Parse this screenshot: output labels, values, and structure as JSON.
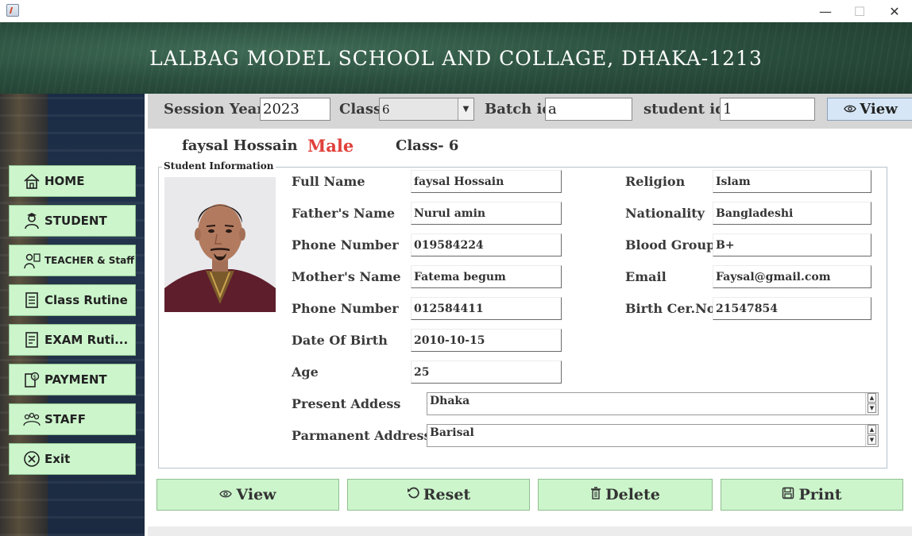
{
  "window": {
    "minimize": "—",
    "maximize": "☐",
    "close": "✕"
  },
  "banner": {
    "title": "LALBAG MODEL SCHOOL AND COLLAGE, DHAKA-1213"
  },
  "sidebar": {
    "items": [
      {
        "label": "HOME",
        "icon": "home-icon"
      },
      {
        "label": "STUDENT",
        "icon": "student-icon"
      },
      {
        "label": "TEACHER & Staff",
        "icon": "teacher-icon"
      },
      {
        "label": "Class Rutine",
        "icon": "schedule-icon"
      },
      {
        "label": "EXAM Ruti...",
        "icon": "exam-icon"
      },
      {
        "label": "PAYMENT",
        "icon": "payment-icon"
      },
      {
        "label": "STAFF",
        "icon": "staff-icon"
      },
      {
        "label": "Exit",
        "icon": "exit-icon"
      }
    ]
  },
  "search": {
    "session_label": "Session Year",
    "session_value": "2023",
    "class_label": "Class",
    "class_value": "6",
    "batch_label": "Batch id",
    "batch_value": "a",
    "student_label": "student id",
    "student_value": "1",
    "view_label": "View"
  },
  "summary": {
    "name": "faysal Hossain",
    "gender": "Male",
    "class": "Class- 6"
  },
  "student_info": {
    "legend": "Student Information",
    "full_name_label": "Full Name",
    "full_name": "faysal Hossain",
    "father_label": "Father's Name",
    "father": "Nurul amin",
    "phone1_label": "Phone Number",
    "phone1": "019584224",
    "mother_label": "Mother's Name",
    "mother": "Fatema begum",
    "phone2_label": "Phone Number",
    "phone2": "012584411",
    "dob_label": "Date Of Birth",
    "dob": "2010-10-15",
    "age_label": "Age",
    "age": "25",
    "religion_label": "Religion",
    "religion": "Islam",
    "nationality_label": "Nationality",
    "nationality": "Bangladeshi",
    "blood_label": "Blood Group",
    "blood": "B+",
    "email_label": "Email",
    "email": "Faysal@gmail.com",
    "birth_cert_label": "Birth Cer.No",
    "birth_cert": "21547854",
    "present_label": "Present Addess",
    "present": "Dhaka",
    "permanent_label": "Parmanent Address",
    "permanent": "Barisal"
  },
  "actions": {
    "view": "View",
    "reset": "Reset",
    "delete": "Delete",
    "print": "Print"
  }
}
